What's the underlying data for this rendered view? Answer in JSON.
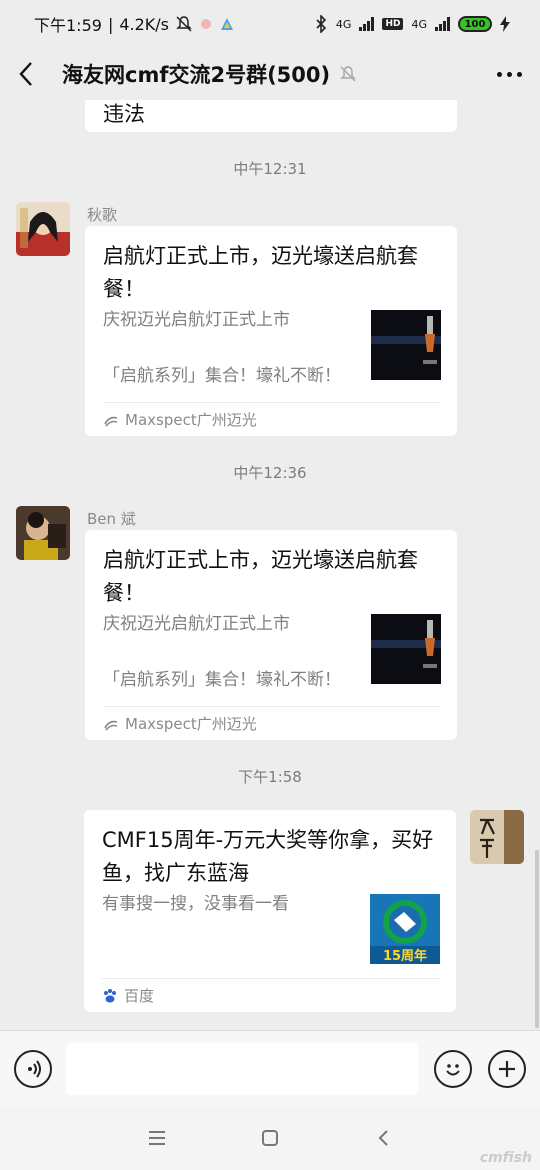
{
  "status_bar": {
    "time": "下午1:59",
    "speed": "4.2K/s",
    "net1": "4G",
    "hd": "HD",
    "net2": "4G",
    "battery": "100"
  },
  "title_bar": {
    "title": "海友网cmf交流2号群(500)"
  },
  "chat": {
    "partial_text": "违法",
    "messages": [
      {
        "time": "中午12:31",
        "sender": "秋歌",
        "card_title": "启航灯正式上市，迈光壕送启航套餐！",
        "card_desc_1": "庆祝迈光启航灯正式上市",
        "card_desc_2": "「启航系列」集合！壕礼不断！",
        "source": "Maxspect广州迈光"
      },
      {
        "time": "中午12:36",
        "sender": "Ben 斌",
        "card_title": "启航灯正式上市，迈光壕送启航套餐！",
        "card_desc_1": "庆祝迈光启航灯正式上市",
        "card_desc_2": "「启航系列」集合！壕礼不断！",
        "source": "Maxspect广州迈光"
      },
      {
        "time": "下午1:58",
        "card_title": "CMF15周年-万元大奖等你拿，买好鱼，找广东蓝海",
        "card_desc_1": "有事搜一搜，没事看一看",
        "thumb_text": "15周年",
        "source": "百度"
      }
    ]
  },
  "watermark": "cmfish"
}
